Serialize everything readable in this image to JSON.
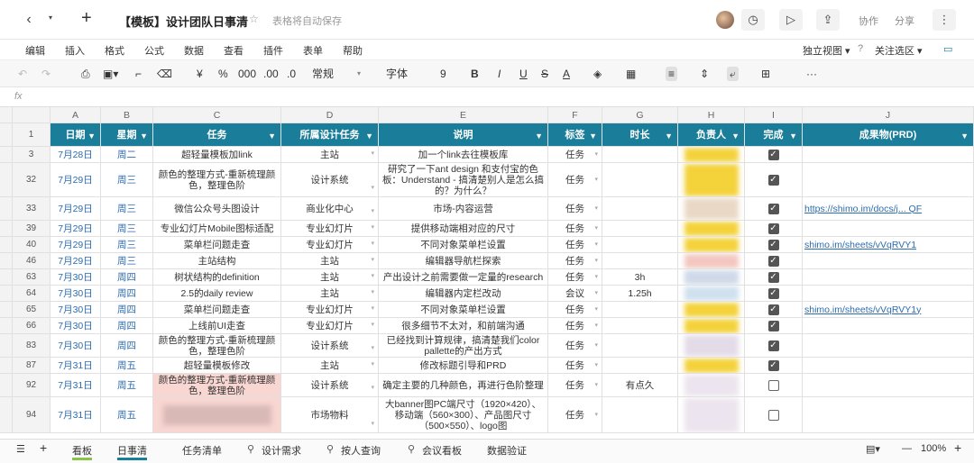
{
  "titlebar": {
    "title": "【模板】设计团队日事清",
    "autosave": "表格将自动保存",
    "collab": "协作",
    "share": "分享",
    "back_icon": "‹",
    "dropdown_icon": "▾",
    "add_icon": "+",
    "star_icon": "☆",
    "history_icon": "◷",
    "present_icon": "▷",
    "export_icon": "⇪",
    "more_icon": "⋮"
  },
  "menu": [
    "编辑",
    "插入",
    "格式",
    "公式",
    "数据",
    "查看",
    "插件",
    "表单",
    "帮助"
  ],
  "menu_right": {
    "view": "独立视图 ▾",
    "help": "?",
    "follow": "关注选区 ▾"
  },
  "toolbar": {
    "undo": "↶",
    "redo": "↷",
    "print": "⎙",
    "paint": "▣▾",
    "format": "⌐",
    "clear": "⌫",
    "currency": "¥",
    "percent": "%",
    "thousands": "000",
    "dec_add": ".00",
    "dec_rm": ".0",
    "numfmt": "常规",
    "font": "字体",
    "size": "9",
    "bold": "B",
    "italic": "I",
    "underline": "U",
    "strike": "S",
    "fontcolor": "A",
    "fill": "◈",
    "border": "▦",
    "align": "≡",
    "valign": "⇕",
    "wrap": "⤶",
    "merge": "⊞",
    "more": "···"
  },
  "fx_label": "fx",
  "columns": [
    "A",
    "B",
    "C",
    "D",
    "E",
    "F",
    "G",
    "H",
    "I",
    "J"
  ],
  "headers": [
    "日期",
    "星期",
    "任务",
    "所属设计任务",
    "说明",
    "标签",
    "时长",
    "负责人",
    "完成",
    "成果物(PRD)"
  ],
  "rows": [
    {
      "num": "3",
      "date": "7月28日",
      "week": "周二",
      "task": "超轻量模板加link",
      "proj": "主站",
      "desc": "加一个link去往模板库",
      "tag": "任务",
      "dur": "",
      "done": true,
      "prd": "",
      "h": 18,
      "owner": "#f3d23a"
    },
    {
      "num": "32",
      "date": "7月29日",
      "week": "周三",
      "task": "颜色的整理方式-重新梳理颜色，整理色阶",
      "proj": "设计系统",
      "desc": "研究了一下ant design 和支付宝的色板：Understand - 搞清楚别人是怎么搞的？为什么？",
      "tag": "任务",
      "dur": "",
      "done": true,
      "prd": "",
      "h": 38,
      "owner": "#f3d23a"
    },
    {
      "num": "33",
      "date": "7月29日",
      "week": "周三",
      "task": "微信公众号头图设计",
      "proj": "商业化中心",
      "desc": "市场-内容运营",
      "tag": "任务",
      "dur": "",
      "done": true,
      "prd": "https://shimo.im/docs/j... QF",
      "h": 26,
      "owner": "#e9d8c6"
    },
    {
      "num": "39",
      "date": "7月29日",
      "week": "周三",
      "task": "专业幻灯片Mobile图标适配",
      "proj": "专业幻灯片",
      "desc": "提供移动端相对应的尺寸",
      "tag": "任务",
      "dur": "",
      "done": true,
      "prd": "",
      "h": 18,
      "owner": "#f3d23a"
    },
    {
      "num": "40",
      "date": "7月29日",
      "week": "周三",
      "task": "菜单栏问题走查",
      "proj": "专业幻灯片",
      "desc": "不同对象菜单栏设置",
      "tag": "任务",
      "dur": "",
      "done": true,
      "prd": "shimo.im/sheets/vVqRVY1",
      "h": 18,
      "owner": "#f3d23a"
    },
    {
      "num": "46",
      "date": "7月29日",
      "week": "周三",
      "task": "主站结构",
      "proj": "主站",
      "desc": "编辑器导航栏探索",
      "tag": "任务",
      "dur": "",
      "done": true,
      "prd": "",
      "h": 18,
      "owner": "#f3c7c0"
    },
    {
      "num": "63",
      "date": "7月30日",
      "week": "周四",
      "task": "树状结构的definition",
      "proj": "主站",
      "desc": "产出设计之前需要做一定量的research",
      "tag": "任务",
      "dur": "3h",
      "done": true,
      "prd": "",
      "h": 18,
      "owner": "#cfd9e8"
    },
    {
      "num": "64",
      "date": "7月30日",
      "week": "周四",
      "task": "2.5的daily review",
      "proj": "主站",
      "desc": "编辑器内定栏改动",
      "tag": "会议",
      "dur": "1.25h",
      "done": true,
      "prd": "",
      "h": 18,
      "owner": "#cfe0ee"
    },
    {
      "num": "65",
      "date": "7月30日",
      "week": "周四",
      "task": "菜单栏问题走查",
      "proj": "专业幻灯片",
      "desc": "不同对象菜单栏设置",
      "tag": "任务",
      "dur": "",
      "done": true,
      "prd": "shimo.im/sheets/vVqRVY1y",
      "h": 18,
      "owner": "#f3d23a"
    },
    {
      "num": "66",
      "date": "7月30日",
      "week": "周四",
      "task": "上线前UI走查",
      "proj": "专业幻灯片",
      "desc": "很多细节不太对，和前端沟通",
      "tag": "任务",
      "dur": "",
      "done": true,
      "prd": "",
      "h": 18,
      "owner": "#f3d23a"
    },
    {
      "num": "83",
      "date": "7月30日",
      "week": "周四",
      "task": "颜色的整理方式-重新梳理颜色，整理色阶",
      "proj": "设计系统",
      "desc": "已经找到计算规律，搞清楚我们color pallette的产出方式",
      "tag": "任务",
      "dur": "",
      "done": true,
      "prd": "",
      "h": 26,
      "owner": "#e4dbe8"
    },
    {
      "num": "87",
      "date": "7月31日",
      "week": "周五",
      "task": "超轻量模板修改",
      "proj": "主站",
      "desc": "修改标题引导和PRD",
      "tag": "任务",
      "dur": "",
      "done": true,
      "prd": "",
      "h": 18,
      "owner": "#f3d23a"
    },
    {
      "num": "92",
      "date": "7月31日",
      "week": "周五",
      "task": "颜色的整理方式-重新梳理颜色，整理色阶",
      "proj": "设计系统",
      "desc": "确定主要的几种颜色，再进行色阶整理",
      "tag": "任务",
      "dur": "有点久",
      "done": false,
      "prd": "",
      "h": 26,
      "owner": "#ece4ee",
      "pink": true
    },
    {
      "num": "94",
      "date": "7月31日",
      "week": "周五",
      "task": "",
      "proj": "市场物料",
      "desc": "大banner图PC端尺寸（1920×420）、移动端（560×300）、产品图尺寸（500×550）、logo图",
      "tag": "任务",
      "dur": "",
      "done": false,
      "prd": "",
      "h": 40,
      "owner": "#ece4ee",
      "blurtask": true
    }
  ],
  "footer": {
    "tabs": [
      "看板",
      "日事清",
      "任务清单",
      "设计需求",
      "按人查询",
      "会议看板",
      "数据验证"
    ],
    "zoom": "100%",
    "menu_icon": "☰",
    "add_icon": "+",
    "minus": "—",
    "plus": "+"
  }
}
